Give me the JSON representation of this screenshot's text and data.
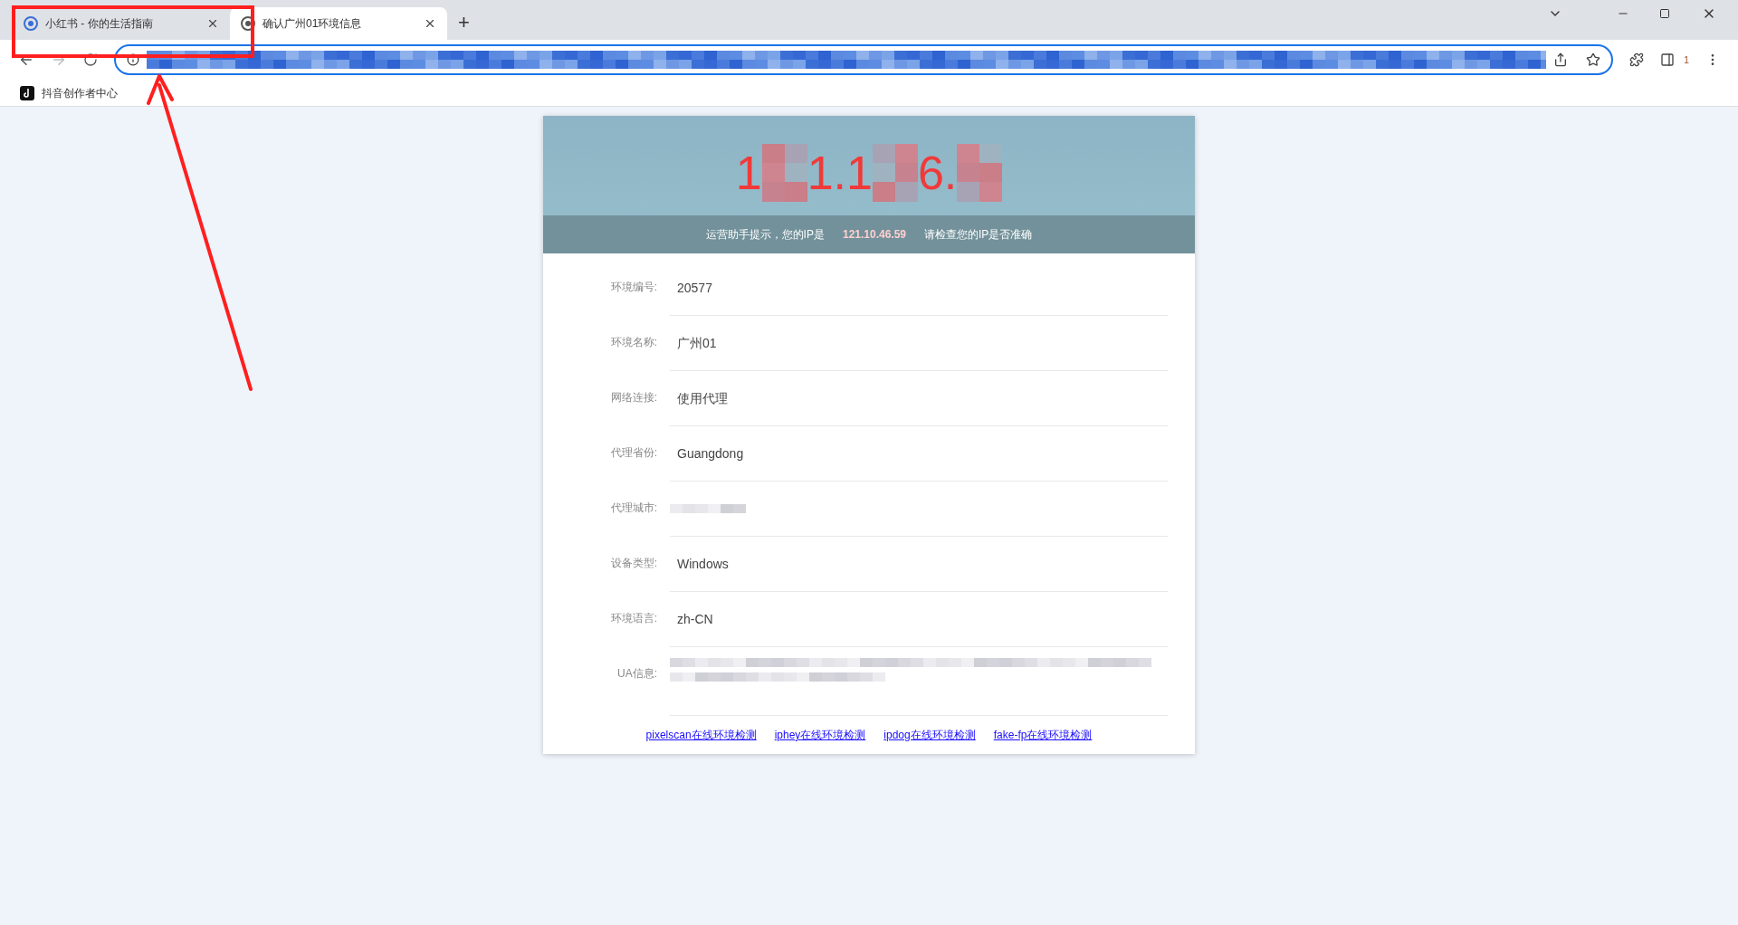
{
  "tabs": [
    {
      "title": "小红书 - 你的生活指南",
      "selected": false
    },
    {
      "title": "确认广州01环境信息",
      "selected": true
    }
  ],
  "new_tab": "+",
  "extension_count": "1",
  "bookmarks": [
    {
      "label": "抖音创作者中心"
    }
  ],
  "card": {
    "ip_fragments": [
      "1",
      "1.1",
      "6."
    ],
    "notice": {
      "before": "运营助手提示，您的IP是",
      "ip": "121.10.46.59",
      "after": "请检查您的IP是否准确"
    },
    "rows": [
      {
        "label": "环境编号:",
        "value": "20577"
      },
      {
        "label": "环境名称:",
        "value": "广州01"
      },
      {
        "label": "网络连接:",
        "value": "使用代理"
      },
      {
        "label": "代理省份:",
        "value": "Guangdong"
      },
      {
        "label": "代理城市:",
        "kind": "redacted"
      },
      {
        "label": "设备类型:",
        "value": "Windows"
      },
      {
        "label": "环境语言:",
        "value": "zh-CN"
      },
      {
        "label": "UA信息:",
        "kind": "redacted_long"
      }
    ],
    "links": [
      "pixelscan在线环境检测",
      "iphey在线环境检测",
      "ipdog在线环境检测",
      "fake-fp在线环境检测"
    ]
  }
}
